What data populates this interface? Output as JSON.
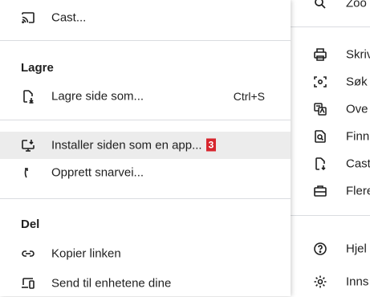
{
  "submenu": {
    "cast_label": "Cast...",
    "save_heading": "Lagre",
    "save_page_label": "Lagre side som...",
    "save_page_shortcut": "Ctrl+S",
    "install_label": "Installer siden som en app...",
    "install_badge": "3",
    "shortcut_label": "Opprett snarvei...",
    "share_heading": "Del",
    "copy_link_label": "Kopier linken",
    "send_devices_label": "Send til enhetene dine"
  },
  "main_menu": {
    "zoom_label": "Zoo",
    "print_label": "Skriv",
    "search_label": "Søk",
    "translate_label": "Ove",
    "find_label": "Finn",
    "cast_save_label": "Cast",
    "more_tools_label": "Flere",
    "help_label": "Hjel",
    "settings_label": "Inns"
  },
  "colors": {
    "highlight": "#ececec",
    "badge": "#d7262e",
    "divider": "#dadce0",
    "text": "#1f1f1f"
  }
}
